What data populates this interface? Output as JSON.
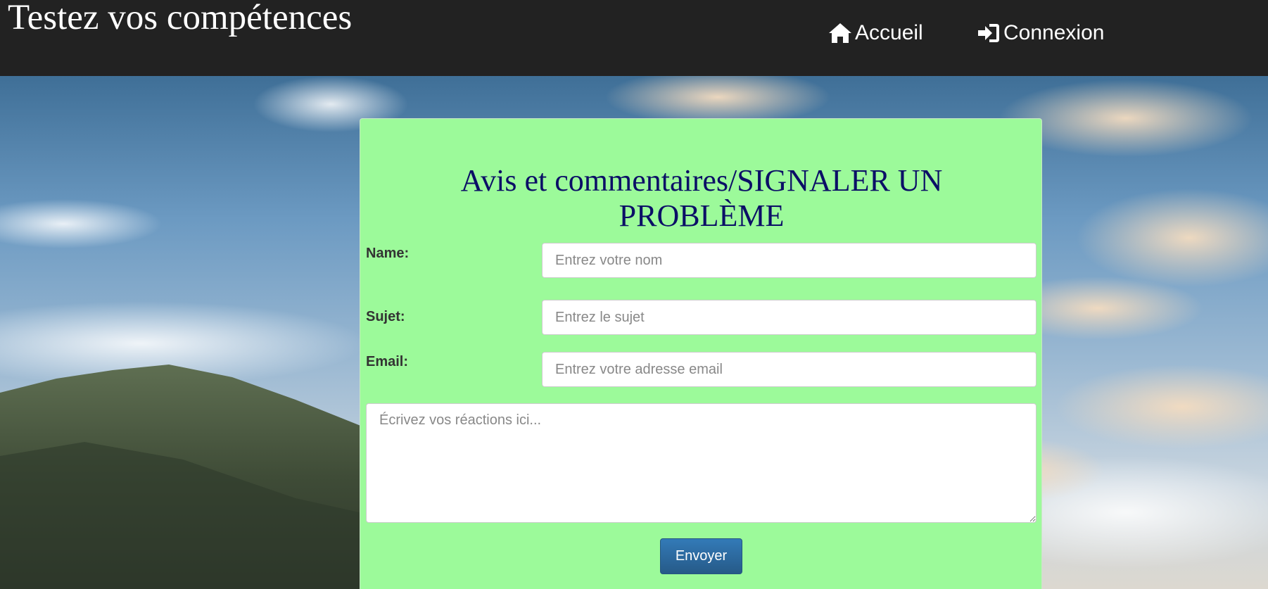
{
  "navbar": {
    "brand": "Testez vos compétences",
    "links": [
      {
        "label": "Accueil",
        "icon": "home-icon"
      },
      {
        "label": "Connexion",
        "icon": "login-icon"
      }
    ]
  },
  "form": {
    "title": "Avis et commentaires/SIGNALER UN PROBLÈME",
    "fields": {
      "name": {
        "label": "Name:",
        "placeholder": "Entrez votre nom",
        "value": ""
      },
      "subject": {
        "label": "Sujet:",
        "placeholder": "Entrez le sujet",
        "value": ""
      },
      "email": {
        "label": "Email:",
        "placeholder": "Entrez votre adresse email",
        "value": ""
      }
    },
    "feedback": {
      "placeholder": "Écrivez vos réactions ici...",
      "value": ""
    },
    "submit_label": "Envoyer"
  },
  "colors": {
    "navbar_bg": "#222222",
    "card_bg": "#9cfa9a",
    "title_color": "#0b0f66",
    "button_bg": "#337ab7"
  }
}
